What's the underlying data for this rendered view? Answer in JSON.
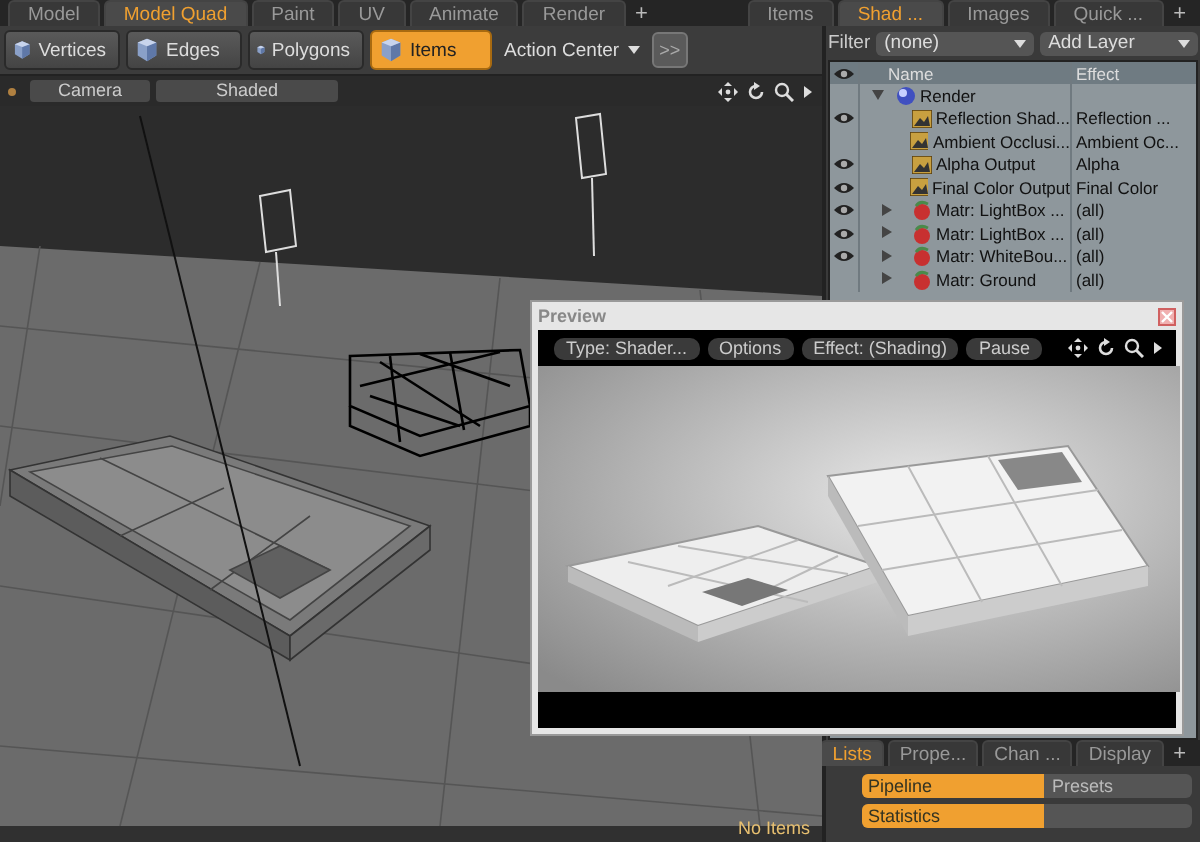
{
  "top_tabs": [
    {
      "label": "Model",
      "selected": false
    },
    {
      "label": "Model Quad",
      "selected": true
    },
    {
      "label": "Paint",
      "selected": false
    },
    {
      "label": "UV",
      "selected": false
    },
    {
      "label": "Animate",
      "selected": false
    },
    {
      "label": "Render",
      "selected": false
    }
  ],
  "top_add": "+",
  "toolbar": {
    "buttons": [
      {
        "label": "Vertices",
        "selected": false
      },
      {
        "label": "Edges",
        "selected": false
      },
      {
        "label": "Polygons",
        "selected": false
      },
      {
        "label": "Items",
        "selected": true
      }
    ],
    "action_center": "Action Center",
    "more": ">>"
  },
  "viewport": {
    "camera": "Camera",
    "shading": "Shaded",
    "status": "No Items"
  },
  "panel_tabs": [
    {
      "label": "Items",
      "selected": false
    },
    {
      "label": "Shad ...",
      "selected": true
    },
    {
      "label": "Images",
      "selected": false
    },
    {
      "label": "Quick ...",
      "selected": false
    }
  ],
  "panel_add": "+",
  "shader_tree": {
    "filter_label": "Filter",
    "filter_value": "(none)",
    "add_layer": "Add Layer",
    "columns": [
      "Name",
      "Effect"
    ],
    "items": [
      {
        "name": "Render",
        "kind": "render",
        "visible": false,
        "expanded": true,
        "children": [
          {
            "name": "Reflection Shad...",
            "effect": "Reflection  ...",
            "kind": "layer",
            "visible": true
          },
          {
            "name": "Ambient Occlusi...",
            "effect": "Ambient Oc...",
            "kind": "layer",
            "visible": false
          },
          {
            "name": "Alpha Output",
            "effect": "Alpha",
            "kind": "layer",
            "visible": true
          },
          {
            "name": "Final Color Output",
            "effect": "Final Color",
            "kind": "layer",
            "visible": true
          },
          {
            "name": "Matr: LightBox  ...",
            "effect": "(all)",
            "kind": "material",
            "visible": true,
            "expanded": false
          },
          {
            "name": "Matr: LightBox  ...",
            "effect": "(all)",
            "kind": "material",
            "visible": true,
            "expanded": false
          },
          {
            "name": "Matr: WhiteBou...",
            "effect": "(all)",
            "kind": "material",
            "visible": true,
            "expanded": false
          },
          {
            "name": "Matr: Ground",
            "effect": "(all)",
            "kind": "material",
            "visible": false,
            "expanded": false
          }
        ]
      }
    ]
  },
  "preview": {
    "title": "Preview",
    "buttons": [
      "Type: Shader...",
      "Options",
      "Effect: (Shading)",
      "Pause"
    ]
  },
  "lists_panel": {
    "tabs": [
      {
        "label": "Lists",
        "selected": true
      },
      {
        "label": "Prope...",
        "selected": false
      },
      {
        "label": "Chan ...",
        "selected": false
      },
      {
        "label": "Display",
        "selected": false
      }
    ],
    "add": "+",
    "rows": [
      {
        "label": "Pipeline",
        "selected": true,
        "value": "Presets"
      },
      {
        "label": "Statistics",
        "selected": true
      }
    ]
  }
}
